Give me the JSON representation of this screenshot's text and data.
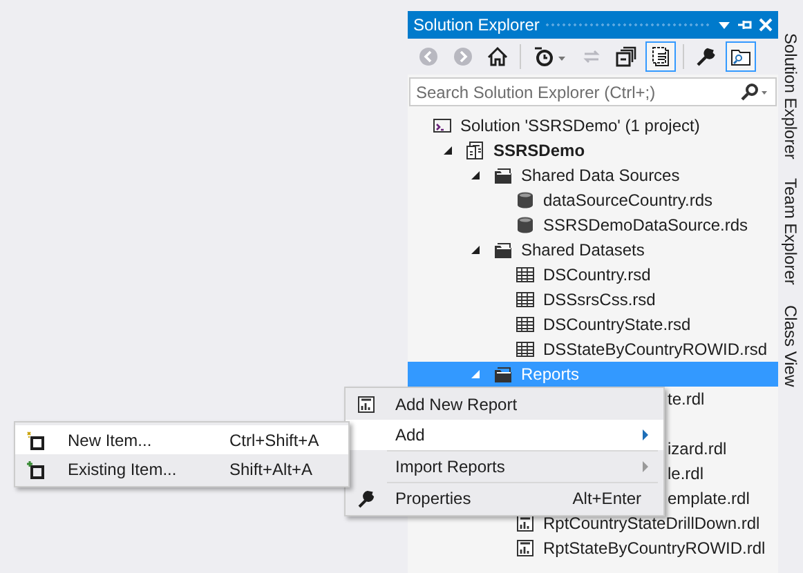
{
  "panel": {
    "title": "Solution Explorer"
  },
  "toolbar": [
    {
      "kind": "back",
      "disabled": true,
      "on": false
    },
    {
      "kind": "forward",
      "disabled": true,
      "on": false
    },
    {
      "kind": "home",
      "disabled": false,
      "on": false
    },
    {
      "kind": "sep"
    },
    {
      "kind": "history",
      "disabled": false,
      "on": false
    },
    {
      "kind": "sync",
      "disabled": true,
      "on": false
    },
    {
      "kind": "collapse",
      "disabled": false,
      "on": false
    },
    {
      "kind": "showall",
      "disabled": false,
      "on": true
    },
    {
      "kind": "sep"
    },
    {
      "kind": "properties",
      "disabled": false,
      "on": false
    },
    {
      "kind": "preview",
      "disabled": false,
      "on": true
    }
  ],
  "search": {
    "placeholder": "Search Solution Explorer (Ctrl+;)"
  },
  "tree": [
    {
      "kind": "solution",
      "label": "Solution 'SSRSDemo' (1 project)",
      "selected": false,
      "children": [
        {
          "kind": "project",
          "label": "SSRSDemo",
          "expanded": true,
          "selected": false,
          "children": [
            {
              "kind": "folder",
              "label": "Shared Data Sources",
              "expanded": true,
              "selected": false,
              "children": [
                {
                  "kind": "datasource",
                  "label": "dataSourceCountry.rds",
                  "selected": false
                },
                {
                  "kind": "datasource",
                  "label": "SSRSDemoDataSource.rds",
                  "selected": false
                }
              ]
            },
            {
              "kind": "folder",
              "label": "Shared Datasets",
              "expanded": true,
              "selected": false,
              "children": [
                {
                  "kind": "dataset",
                  "label": "DSCountry.rsd",
                  "selected": false
                },
                {
                  "kind": "dataset",
                  "label": "DSSsrsCss.rsd",
                  "selected": false
                },
                {
                  "kind": "dataset",
                  "label": "DSCountryState.rsd",
                  "selected": false
                },
                {
                  "kind": "dataset",
                  "label": "DSStateByCountryROWID.rsd",
                  "selected": false
                }
              ]
            },
            {
              "kind": "folder",
              "label": "Reports",
              "expanded": true,
              "selected": true,
              "children": [
                {
                  "kind": "fragment",
                  "label": "te.rdl",
                  "selected": false
                },
                {
                  "kind": "hidden"
                },
                {
                  "kind": "fragment",
                  "label": "izard.rdl",
                  "selected": false
                },
                {
                  "kind": "fragment",
                  "label": "le.rdl",
                  "selected": false
                },
                {
                  "kind": "fragment",
                  "label": "emplate.rdl",
                  "selected": false
                },
                {
                  "kind": "report",
                  "label": "RptCountryStateDrillDown.rdl",
                  "selected": false
                },
                {
                  "kind": "report",
                  "label": "RptStateByCountryROWID.rdl",
                  "selected": false
                }
              ]
            }
          ]
        }
      ]
    }
  ],
  "side_tabs": [
    "Solution Explorer",
    "Team Explorer",
    "Class View"
  ],
  "context_menu": [
    {
      "kind": "report",
      "label": "Add New Report",
      "selected": false
    },
    {
      "kind": "submenu",
      "label": "Add",
      "selected": true
    },
    {
      "kind": "submenu",
      "label": "Import Reports",
      "selected": false
    },
    {
      "kind": "properties",
      "label": "Properties",
      "shortcut": "Alt+Enter",
      "selected": false
    }
  ],
  "submenu": [
    {
      "kind": "new",
      "label": "New Item...",
      "shortcut": "Ctrl+Shift+A",
      "selected": true
    },
    {
      "kind": "existing",
      "label": "Existing Item...",
      "shortcut": "Shift+Alt+A",
      "selected": false
    }
  ]
}
